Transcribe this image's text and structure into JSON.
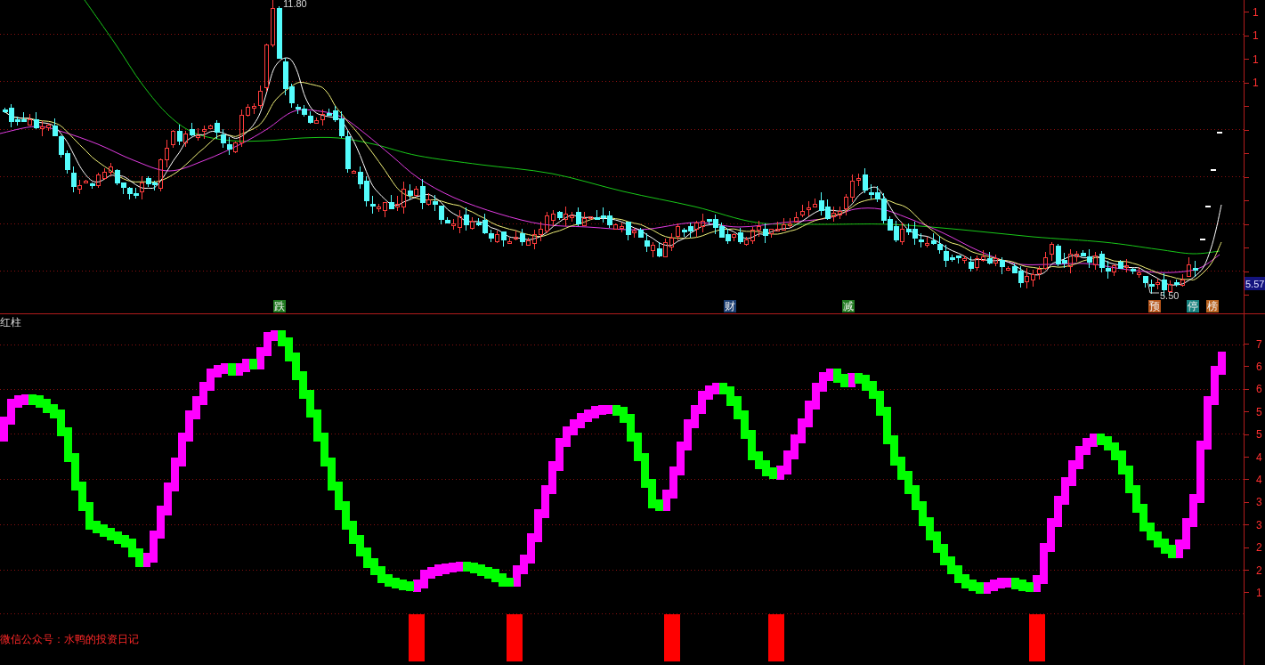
{
  "price_pane": {
    "high_label": "11.80",
    "low_label": "5.50",
    "signal_markers": [
      {
        "label": "跌",
        "color": "#1f7a1f"
      },
      {
        "label": "财",
        "color": "#1c3f73"
      },
      {
        "label": "减",
        "color": "#1f7a1f"
      },
      {
        "label": "预",
        "color": "#b8561a"
      },
      {
        "label": "停",
        "color": "#16827f"
      },
      {
        "label": "榜",
        "color": "#b8621e"
      }
    ],
    "axis": {
      "labels": [
        "1",
        "1",
        "1",
        "1"
      ],
      "last_price": "5.57"
    }
  },
  "indicator_pane": {
    "title": "红柱",
    "axis": {
      "labels": [
        "7",
        "6",
        "6",
        "5",
        "5",
        "4",
        "4",
        "3",
        "3",
        "2",
        "2",
        "1"
      ]
    }
  },
  "footer": {
    "text": "微信公众号：水鸭的投资日记"
  }
}
